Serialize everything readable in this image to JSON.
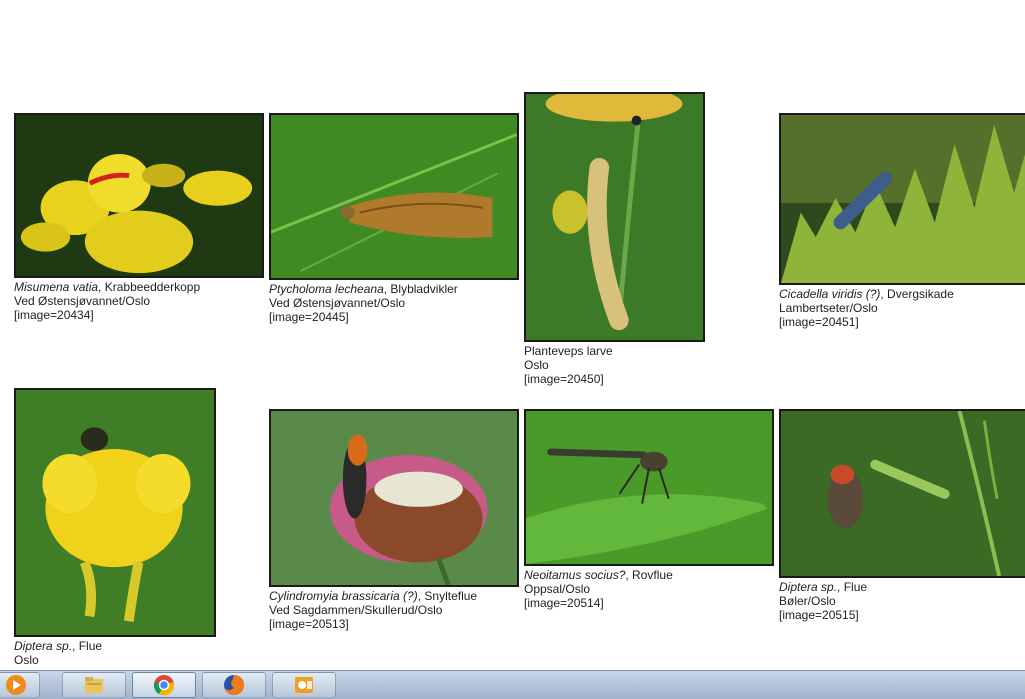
{
  "gallery": [
    {
      "sci": "Misumena vatia",
      "common": ", Krabbeedderkopp",
      "place": "Ved Østensjøvannet/Oslo",
      "image_id": "[image=20434]"
    },
    {
      "sci": "Ptycholoma lecheana",
      "common": ", Blybladvikler",
      "place": "Ved Østensjøvannet/Oslo",
      "image_id": "[image=20445]"
    },
    {
      "sci": "",
      "common": "Planteveps larve",
      "place": "Oslo",
      "image_id": "[image=20450]"
    },
    {
      "sci": "Cicadella viridis (?)",
      "common": ", Dvergsikade",
      "place": "Lambertseter/Oslo",
      "image_id": "[image=20451]"
    },
    {
      "sci": "Diptera sp.",
      "common": ", Flue",
      "place": "Oslo",
      "image_id": ""
    },
    {
      "sci": "Cylindromyia brassicaria (?)",
      "common": ", Snylteflue",
      "place": "Ved Sagdammen/Skullerud/Oslo",
      "image_id": "[image=20513]"
    },
    {
      "sci": "Neoitamus socius?",
      "common": ", Rovflue",
      "place": "Oppsal/Oslo",
      "image_id": "[image=20514]"
    },
    {
      "sci": "Diptera sp.",
      "common": ", Flue",
      "place": "Bøler/Oslo",
      "image_id": "[image=20515]"
    }
  ],
  "taskbar": {
    "items": [
      {
        "icon": "media-player-icon"
      },
      {
        "icon": "file-explorer-icon"
      },
      {
        "icon": "chrome-icon",
        "active": true
      },
      {
        "icon": "firefox-icon"
      },
      {
        "icon": "outlook-icon"
      }
    ]
  }
}
